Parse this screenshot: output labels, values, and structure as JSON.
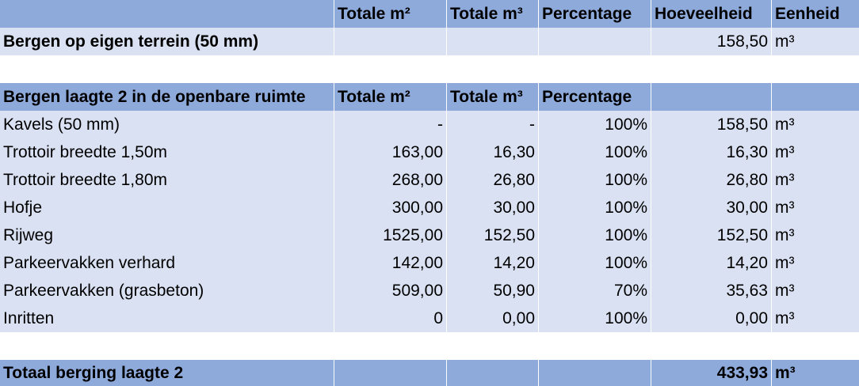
{
  "header": {
    "col1": "",
    "col2": "Totale m²",
    "col3": "Totale m³",
    "col4": "Percentage",
    "col5": "Hoeveelheid",
    "col6": "Eenheid"
  },
  "eigen_terrein": {
    "label": "Bergen op eigen terrein (50 mm)",
    "hoeveelheid": "158,50",
    "eenheid": "m³"
  },
  "section2_header": {
    "label": "Bergen laagte 2 in de openbare ruimte",
    "col2": "Totale m²",
    "col3": "Totale m³",
    "col4": "Percentage"
  },
  "rows": [
    {
      "label": "Kavels (50 mm)",
      "m2": "-",
      "m3": "-",
      "pct": "100%",
      "qty": "158,50",
      "unit": "m³"
    },
    {
      "label": "Trottoir breedte 1,50m",
      "m2": "163,00",
      "m3": "16,30",
      "pct": "100%",
      "qty": "16,30",
      "unit": "m³"
    },
    {
      "label": "Trottoir breedte 1,80m",
      "m2": "268,00",
      "m3": "26,80",
      "pct": "100%",
      "qty": "26,80",
      "unit": "m³"
    },
    {
      "label": "Hofje",
      "m2": "300,00",
      "m3": "30,00",
      "pct": "100%",
      "qty": "30,00",
      "unit": "m³"
    },
    {
      "label": "Rijweg",
      "m2": "1525,00",
      "m3": "152,50",
      "pct": "100%",
      "qty": "152,50",
      "unit": "m³"
    },
    {
      "label": "Parkeervakken verhard",
      "m2": "142,00",
      "m3": "14,20",
      "pct": "100%",
      "qty": "14,20",
      "unit": "m³"
    },
    {
      "label": "Parkeervakken (grasbeton)",
      "m2": "509,00",
      "m3": "50,90",
      "pct": "70%",
      "qty": "35,63",
      "unit": "m³"
    },
    {
      "label": "Inritten",
      "m2": "0",
      "m3": "0,00",
      "pct": "100%",
      "qty": "0,00",
      "unit": "m³"
    }
  ],
  "total": {
    "label": "Totaal berging laagte 2",
    "qty": "433,93",
    "unit": "m³"
  },
  "colors": {
    "header_fill": "#8eaadb",
    "row_fill": "#d9e1f2"
  }
}
